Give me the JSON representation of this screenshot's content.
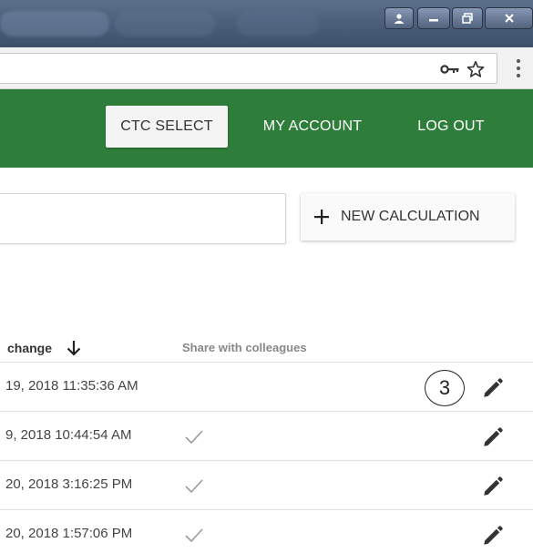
{
  "header": {
    "nav": [
      {
        "label": "CTC SELECT"
      },
      {
        "label": "MY ACCOUNT"
      },
      {
        "label": "LOG OUT"
      }
    ],
    "brand_color": "#2e7d3a"
  },
  "actions": {
    "new_calculation_label": "NEW CALCULATION"
  },
  "table": {
    "columns": {
      "last_change": "change",
      "share": "Share with colleagues"
    },
    "rows": [
      {
        "date": "19, 2018 11:35:36 AM",
        "shared": false
      },
      {
        "date": "9, 2018 10:44:54 AM",
        "shared": true
      },
      {
        "date": "20, 2018 3:16:25 PM",
        "shared": true
      },
      {
        "date": "20, 2018 1:57:06 PM",
        "shared": true
      }
    ]
  },
  "annotation": {
    "callout_number": "3"
  },
  "icons": {
    "key": "key-icon",
    "star": "star-icon",
    "menu": "kebab-menu-icon",
    "plus": "plus-icon",
    "sort": "arrow-down-icon",
    "check": "check-icon",
    "edit": "pencil-icon"
  }
}
